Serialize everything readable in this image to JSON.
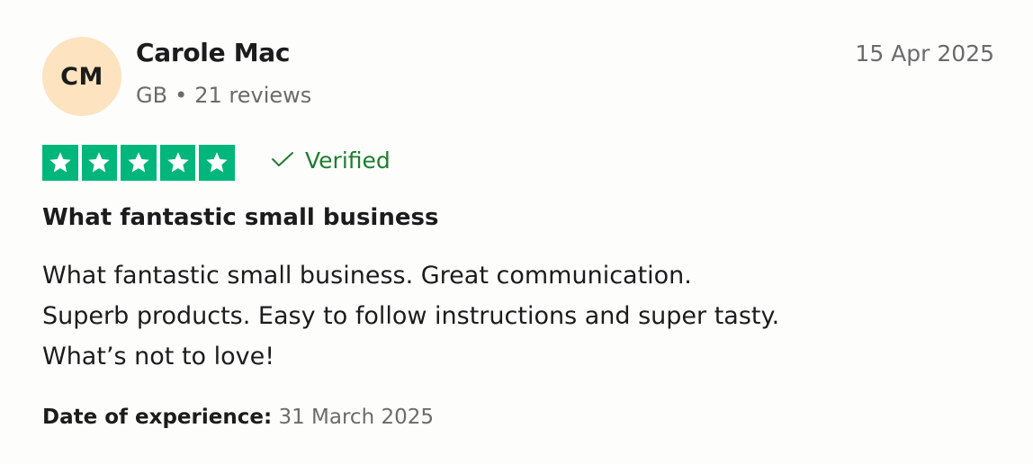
{
  "reviewer": {
    "initials": "CM",
    "name": "Carole Mac",
    "country": "GB",
    "separator": "•",
    "reviews_count": "21 reviews"
  },
  "review": {
    "date": "15 Apr 2025",
    "rating": 5,
    "rating_max": 5,
    "verified_label": "Verified",
    "title": "What fantastic small business",
    "body_lines": [
      "What fantastic small business. Great communication.",
      "Superb products. Easy to follow instructions and super tasty.",
      "What’s not to love!"
    ],
    "experience_label": "Date of experience:",
    "experience_date": "31 March 2025"
  },
  "colors": {
    "star_green": "#00b67a",
    "verified_green": "#1e7d2f",
    "avatar_bg": "#fde3bf"
  },
  "icons": {
    "star": "star-icon",
    "verified": "check-icon"
  }
}
